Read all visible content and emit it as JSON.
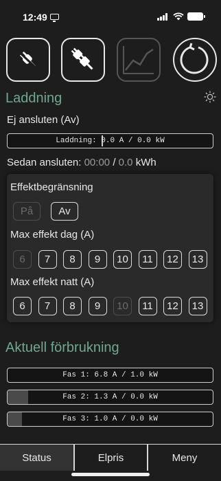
{
  "status_bar": {
    "time": "12:49"
  },
  "toolbar": {
    "buttons": [
      {
        "icon": "plug-disconnect-icon",
        "enabled": true
      },
      {
        "icon": "plug-connect-icon",
        "enabled": true
      },
      {
        "icon": "line-chart-icon",
        "enabled": false
      },
      {
        "icon": "refresh-icon",
        "enabled": true
      }
    ]
  },
  "charging": {
    "title": "Laddning",
    "settings_icon": "sun-icon",
    "state": "Ej ansluten (Av)",
    "bar_text": "Laddning: 0.0 A / 0.0 kW",
    "bar_fraction": 0.0,
    "since_label": "Sedan ansluten:",
    "since_time": "00:00",
    "since_sep": "/",
    "since_energy": "0.0",
    "since_unit": "kWh"
  },
  "power_limit": {
    "title": "Effektbegränsning",
    "toggle": [
      {
        "label": "På",
        "selected": false
      },
      {
        "label": "Av",
        "selected": true
      }
    ],
    "day_label": "Max effekt dag (A)",
    "day_values": [
      "6",
      "7",
      "8",
      "9",
      "10",
      "11",
      "12",
      "13"
    ],
    "day_selected": "6",
    "night_label": "Max effekt natt (A)",
    "night_values": [
      "6",
      "7",
      "8",
      "9",
      "10",
      "11",
      "12",
      "13"
    ],
    "night_selected": "10"
  },
  "consumption": {
    "title": "Aktuell förbrukning",
    "phases": [
      {
        "text": "Fas 1: 6.8 A / 1.0 kW",
        "fraction": 0.0
      },
      {
        "text": "Fas 2: 1.3 A / 0.0 kW",
        "fraction": 0.1
      },
      {
        "text": "Fas 3: 1.0 A / 0.0 kW",
        "fraction": 0.07
      }
    ]
  },
  "tabs": [
    {
      "label": "Status",
      "active": true
    },
    {
      "label": "Elpris",
      "active": false
    },
    {
      "label": "Meny",
      "active": false
    }
  ],
  "colors": {
    "accent": "#6fa891",
    "background": "#1d1d1d",
    "card": "#2a2a2a"
  }
}
